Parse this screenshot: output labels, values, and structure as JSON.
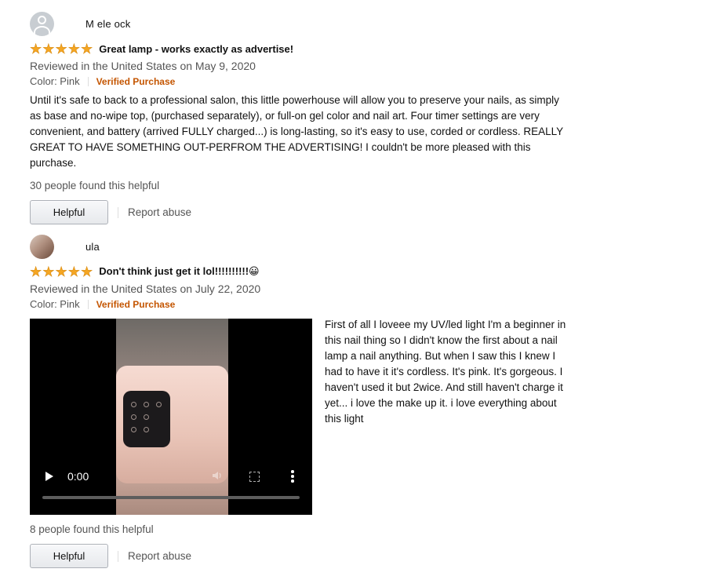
{
  "reviews": [
    {
      "profile_name": "M ele ock",
      "rating": 5,
      "title": "Great lamp - works exactly as advertise!",
      "date": "Reviewed in the United States on May 9, 2020",
      "color": "Color: Pink",
      "verified": "Verified Purchase",
      "body": "Until it's safe to back to a professional salon, this little powerhouse will allow you to preserve your nails, as simply as base and no-wipe top, (purchased separately), or full-on gel color and nail art. Four timer settings are very convenient, and battery (arrived FULLY charged...) is long-lasting, so it's easy to use, corded or cordless. REALLY GREAT TO HAVE SOMETHING OUT-PERFROM THE ADVERTISING! I couldn't be more pleased with this purchase.",
      "helpful_count": "30 people found this helpful",
      "helpful_label": "Helpful",
      "report_label": "Report abuse"
    },
    {
      "profile_name": "ula",
      "rating": 5,
      "title": "Don't think just get it lol!!!!!!!!!!😀",
      "date": "Reviewed in the United States on July 22, 2020",
      "color": "Color: Pink",
      "verified": "Verified Purchase",
      "video_time": "0:00",
      "body": " First of all I loveee my UV/led light I'm a beginner in this nail thing so I didn't know the first about a nail lamp a nail anything. But when I saw this I knew I had to have it it's cordless. It's pink. It's gorgeous. I haven't used it but 2wice. And still haven't charge it yet... i love the make up it. i love everything about this light",
      "helpful_count": "8 people found this helpful",
      "helpful_label": "Helpful",
      "report_label": "Report abuse"
    }
  ],
  "colors": {
    "star": "#f5a623",
    "verified": "#c45500",
    "meta_text": "#555555"
  },
  "icons": [
    "default-avatar-icon",
    "star-icon",
    "play-icon",
    "volume-icon",
    "fullscreen-icon",
    "more-options-icon"
  ]
}
